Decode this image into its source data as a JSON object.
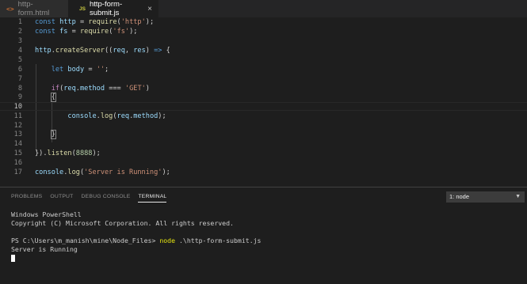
{
  "tabs": [
    {
      "icon": "html-file-icon",
      "label": "http-form.html",
      "active": false
    },
    {
      "icon": "js-file-icon",
      "label": "http-form-submit.js",
      "active": true
    }
  ],
  "tab_icon_text": {
    "html": "<>",
    "js": "JS"
  },
  "close_glyph": "×",
  "editor": {
    "line_numbers": [
      "1",
      "2",
      "3",
      "4",
      "5",
      "6",
      "7",
      "8",
      "9",
      "10",
      "11",
      "12",
      "13",
      "14",
      "15",
      "16",
      "17"
    ],
    "current_line": "10"
  },
  "panel": {
    "tabs": [
      "PROBLEMS",
      "OUTPUT",
      "DEBUG CONSOLE",
      "TERMINAL"
    ],
    "active_tab": "TERMINAL",
    "terminal_select": "1: node",
    "terminal_lines": [
      "Windows PowerShell",
      "Copyright (C) Microsoft Corporation. All rights reserved.",
      "",
      "PS C:\\Users\\m_manish\\mine\\Node_Files> ",
      "Server is Running"
    ],
    "command": "node",
    "command_args": " .\\http-form-submit.js"
  },
  "colors": {
    "keyword": "#569cd6",
    "string": "#ce9178",
    "function": "#dcdcaa",
    "variable": "#9cdcfe",
    "number": "#b5cea8",
    "control": "#c586c0",
    "terminal_command": "#e5e510"
  }
}
